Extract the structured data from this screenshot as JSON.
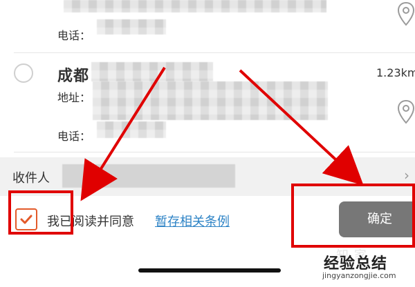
{
  "entries": [
    {
      "phone_label": "电话："
    },
    {
      "name": "成都",
      "address_label": "地址：",
      "phone_label": "电话：",
      "distance": "1.23km"
    }
  ],
  "recipient": {
    "label": "收件人",
    "chevron": "›"
  },
  "agreement": {
    "text": "我已阅读并同意",
    "link": "暂存相关条例"
  },
  "actions": {
    "confirm_label": "确定"
  },
  "watermark": {
    "main": "经验总结",
    "sub": "jingyanzongjie.com"
  },
  "colors": {
    "accent": "#e35a2a",
    "link": "#2f84c6",
    "button": "#777777",
    "annotation": "#e00000"
  }
}
